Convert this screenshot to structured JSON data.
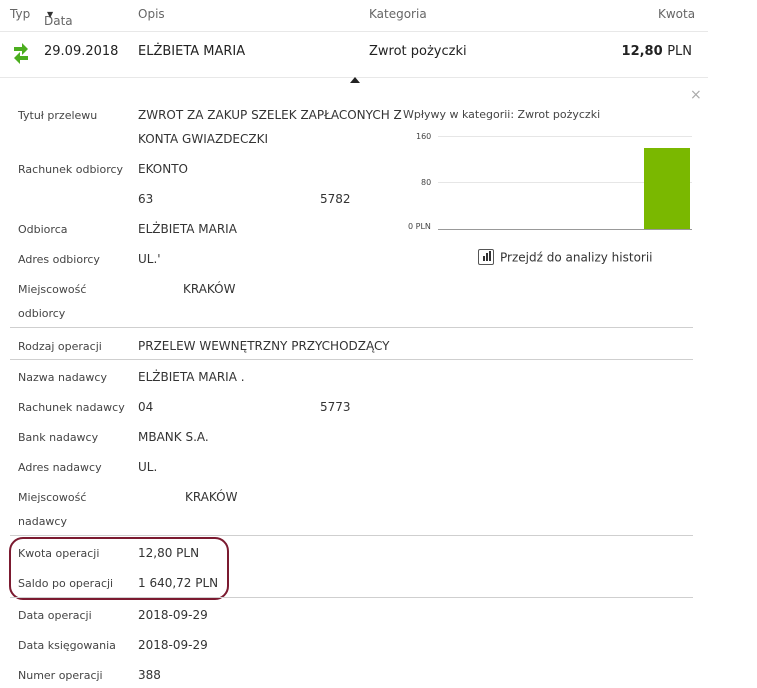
{
  "header": {
    "typ": "Typ",
    "data": "Data",
    "opis": "Opis",
    "kategoria": "Kategoria",
    "kwota": "Kwota"
  },
  "transaction": {
    "date": "29.09.2018",
    "desc": "ELŻBIETA MARIA",
    "category": "Zwrot pożyczki",
    "amount": "12,80",
    "currency": "PLN"
  },
  "details": {
    "tytul_label": "Tytuł przelewu",
    "tytul_line1": "ZWROT ZA ZAKUP SZELEK ZAPŁACONYCH Z",
    "tytul_line2": "KONTA GWIAZDECZKI",
    "rach_odb_label": "Rachunek odbiorcy",
    "rach_odb_name": "EKONTO",
    "rach_odb_num_a": "63",
    "rach_odb_num_b": "5782",
    "odbiorca_label": "Odbiorca",
    "odbiorca_val": "ELŻBIETA MARIA",
    "adres_odb_label": "Adres odbiorcy",
    "adres_odb_val": "UL.'",
    "miejsc_odb_label1": "Miejscowość",
    "miejsc_odb_label2": "odbiorcy",
    "miejsc_odb_val": "KRAKÓW",
    "rodzaj_label": "Rodzaj operacji",
    "rodzaj_val": "PRZELEW WEWNĘTRZNY PRZYCHODZĄCY",
    "nazwa_nad_label": "Nazwa nadawcy",
    "nazwa_nad_val": "ELŻBIETA MARIA .",
    "rach_nad_label": "Rachunek nadawcy",
    "rach_nad_num_a": "04",
    "rach_nad_num_b": "5773",
    "bank_nad_label": "Bank nadawcy",
    "bank_nad_val": "MBANK S.A.",
    "adres_nad_label": "Adres nadawcy",
    "adres_nad_val": "UL.",
    "miejsc_nad_label1": "Miejscowość",
    "miejsc_nad_label2": "nadawcy",
    "miejsc_nad_val": "KRAKÓW",
    "kwota_op_label": "Kwota operacji",
    "kwota_op_val": "12,80 PLN",
    "saldo_label": "Saldo po operacji",
    "saldo_val": "1 640,72 PLN",
    "data_op_label": "Data operacji",
    "data_op_val": "2018-09-29",
    "data_ks_label": "Data księgowania",
    "data_ks_val": "2018-09-29",
    "numer_label": "Numer operacji",
    "numer_val": "388"
  },
  "history_link": "Przejdź do analizy historii",
  "close_symbol": "×",
  "accent_color": "#7ab800",
  "highlight_color": "#7b1a30",
  "chart_data": {
    "type": "bar",
    "title": "Wpływy w kategorii:  Zwrot pożyczki",
    "ytick_labels": [
      "160",
      "80",
      "0 PLN"
    ],
    "yticks": [
      160,
      80,
      0
    ],
    "ylim": [
      0,
      160
    ],
    "series": [
      {
        "values": [
          0,
          0,
          0,
          0,
          140
        ]
      }
    ],
    "grid": true
  }
}
